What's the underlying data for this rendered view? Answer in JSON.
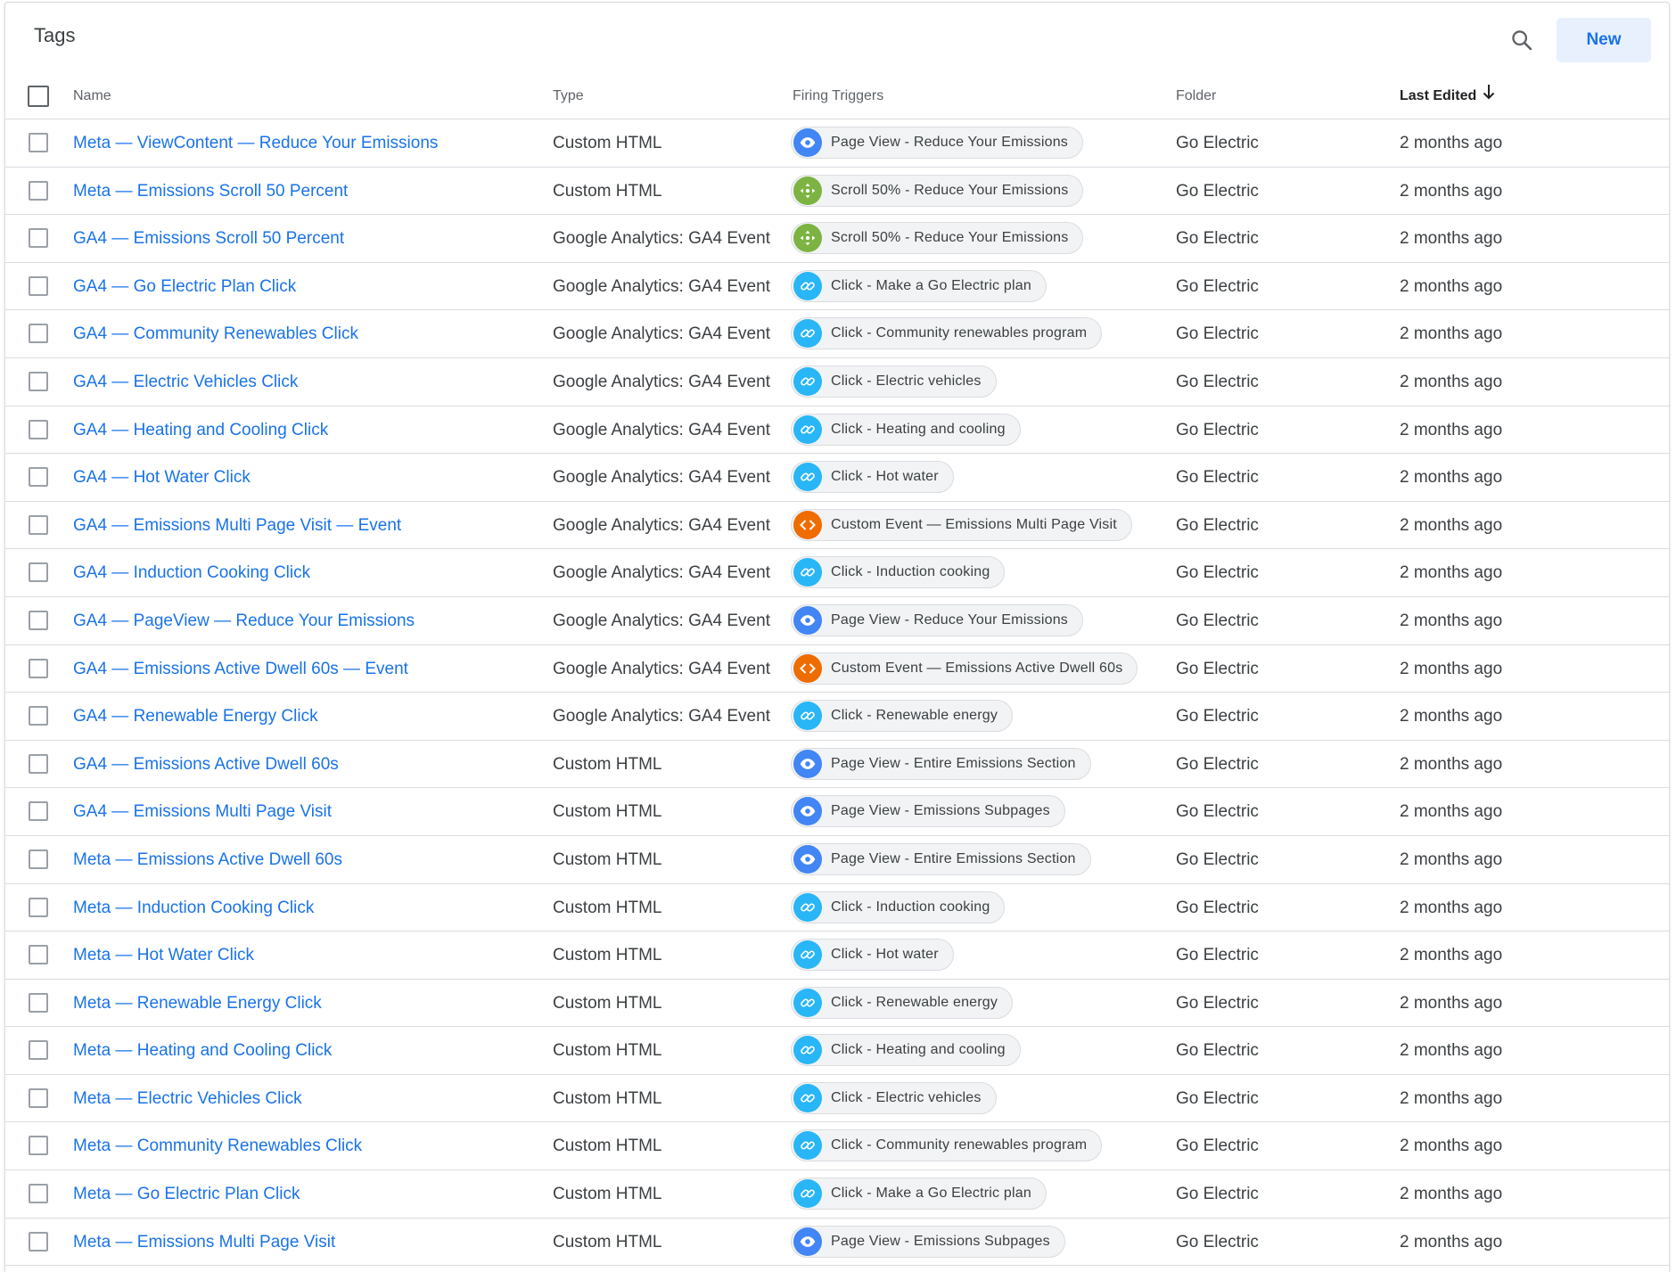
{
  "header": {
    "title": "Tags",
    "new_label": "New"
  },
  "colors": {
    "link": "#1a73e8",
    "pageview": "#4285f4",
    "scroll": "#7cb342",
    "click": "#29b6f6",
    "custom_event": "#ef6c00"
  },
  "columns": {
    "name": "Name",
    "type": "Type",
    "triggers": "Firing Triggers",
    "folder": "Folder",
    "edited": "Last Edited"
  },
  "rows": [
    {
      "name": "Meta — ViewContent — Reduce Your Emissions",
      "type": "Custom HTML",
      "trigger": "Page View - Reduce Your Emissions",
      "trigger_icon": "pageview",
      "folder": "Go Electric",
      "edited": "2 months ago"
    },
    {
      "name": "Meta — Emissions Scroll 50 Percent",
      "type": "Custom HTML",
      "trigger": "Scroll 50% - Reduce Your Emissions",
      "trigger_icon": "scroll",
      "folder": "Go Electric",
      "edited": "2 months ago"
    },
    {
      "name": "GA4 — Emissions Scroll 50 Percent",
      "type": "Google Analytics: GA4 Event",
      "trigger": "Scroll 50% - Reduce Your Emissions",
      "trigger_icon": "scroll",
      "folder": "Go Electric",
      "edited": "2 months ago"
    },
    {
      "name": "GA4 — Go Electric Plan Click",
      "type": "Google Analytics: GA4 Event",
      "trigger": "Click - Make a Go Electric plan",
      "trigger_icon": "click",
      "folder": "Go Electric",
      "edited": "2 months ago"
    },
    {
      "name": "GA4 — Community Renewables Click",
      "type": "Google Analytics: GA4 Event",
      "trigger": "Click - Community renewables program",
      "trigger_icon": "click",
      "folder": "Go Electric",
      "edited": "2 months ago"
    },
    {
      "name": "GA4 — Electric Vehicles Click",
      "type": "Google Analytics: GA4 Event",
      "trigger": "Click - Electric vehicles",
      "trigger_icon": "click",
      "folder": "Go Electric",
      "edited": "2 months ago"
    },
    {
      "name": "GA4 — Heating and Cooling Click",
      "type": "Google Analytics: GA4 Event",
      "trigger": "Click - Heating and cooling",
      "trigger_icon": "click",
      "folder": "Go Electric",
      "edited": "2 months ago"
    },
    {
      "name": "GA4 — Hot Water Click",
      "type": "Google Analytics: GA4 Event",
      "trigger": "Click - Hot water",
      "trigger_icon": "click",
      "folder": "Go Electric",
      "edited": "2 months ago"
    },
    {
      "name": "GA4 — Emissions Multi Page Visit — Event",
      "type": "Google Analytics: GA4 Event",
      "trigger": "Custom Event — Emissions Multi Page Visit",
      "trigger_icon": "custom_event",
      "folder": "Go Electric",
      "edited": "2 months ago"
    },
    {
      "name": "GA4 — Induction Cooking Click",
      "type": "Google Analytics: GA4 Event",
      "trigger": "Click - Induction cooking",
      "trigger_icon": "click",
      "folder": "Go Electric",
      "edited": "2 months ago"
    },
    {
      "name": "GA4 — PageView — Reduce Your Emissions",
      "type": "Google Analytics: GA4 Event",
      "trigger": "Page View - Reduce Your Emissions",
      "trigger_icon": "pageview",
      "folder": "Go Electric",
      "edited": "2 months ago"
    },
    {
      "name": "GA4 — Emissions Active Dwell 60s — Event",
      "type": "Google Analytics: GA4 Event",
      "trigger": "Custom Event — Emissions Active Dwell 60s",
      "trigger_icon": "custom_event",
      "folder": "Go Electric",
      "edited": "2 months ago"
    },
    {
      "name": "GA4 — Renewable Energy Click",
      "type": "Google Analytics: GA4 Event",
      "trigger": "Click - Renewable energy",
      "trigger_icon": "click",
      "folder": "Go Electric",
      "edited": "2 months ago"
    },
    {
      "name": "GA4 — Emissions Active Dwell 60s",
      "type": "Custom HTML",
      "trigger": "Page View - Entire Emissions Section",
      "trigger_icon": "pageview",
      "folder": "Go Electric",
      "edited": "2 months ago"
    },
    {
      "name": "GA4 — Emissions Multi Page Visit",
      "type": "Custom HTML",
      "trigger": "Page View - Emissions Subpages",
      "trigger_icon": "pageview",
      "folder": "Go Electric",
      "edited": "2 months ago"
    },
    {
      "name": "Meta — Emissions Active Dwell 60s",
      "type": "Custom HTML",
      "trigger": "Page View - Entire Emissions Section",
      "trigger_icon": "pageview",
      "folder": "Go Electric",
      "edited": "2 months ago"
    },
    {
      "name": "Meta — Induction Cooking Click",
      "type": "Custom HTML",
      "trigger": "Click - Induction cooking",
      "trigger_icon": "click",
      "folder": "Go Electric",
      "edited": "2 months ago"
    },
    {
      "name": "Meta — Hot Water Click",
      "type": "Custom HTML",
      "trigger": "Click - Hot water",
      "trigger_icon": "click",
      "folder": "Go Electric",
      "edited": "2 months ago"
    },
    {
      "name": "Meta — Renewable Energy Click",
      "type": "Custom HTML",
      "trigger": "Click - Renewable energy",
      "trigger_icon": "click",
      "folder": "Go Electric",
      "edited": "2 months ago"
    },
    {
      "name": "Meta — Heating and Cooling Click",
      "type": "Custom HTML",
      "trigger": "Click - Heating and cooling",
      "trigger_icon": "click",
      "folder": "Go Electric",
      "edited": "2 months ago"
    },
    {
      "name": "Meta — Electric Vehicles Click",
      "type": "Custom HTML",
      "trigger": "Click - Electric vehicles",
      "trigger_icon": "click",
      "folder": "Go Electric",
      "edited": "2 months ago"
    },
    {
      "name": "Meta — Community Renewables Click",
      "type": "Custom HTML",
      "trigger": "Click - Community renewables program",
      "trigger_icon": "click",
      "folder": "Go Electric",
      "edited": "2 months ago"
    },
    {
      "name": "Meta — Go Electric Plan Click",
      "type": "Custom HTML",
      "trigger": "Click - Make a Go Electric plan",
      "trigger_icon": "click",
      "folder": "Go Electric",
      "edited": "2 months ago"
    },
    {
      "name": "Meta — Emissions Multi Page Visit",
      "type": "Custom HTML",
      "trigger": "Page View - Emissions Subpages",
      "trigger_icon": "pageview",
      "folder": "Go Electric",
      "edited": "2 months ago"
    }
  ]
}
